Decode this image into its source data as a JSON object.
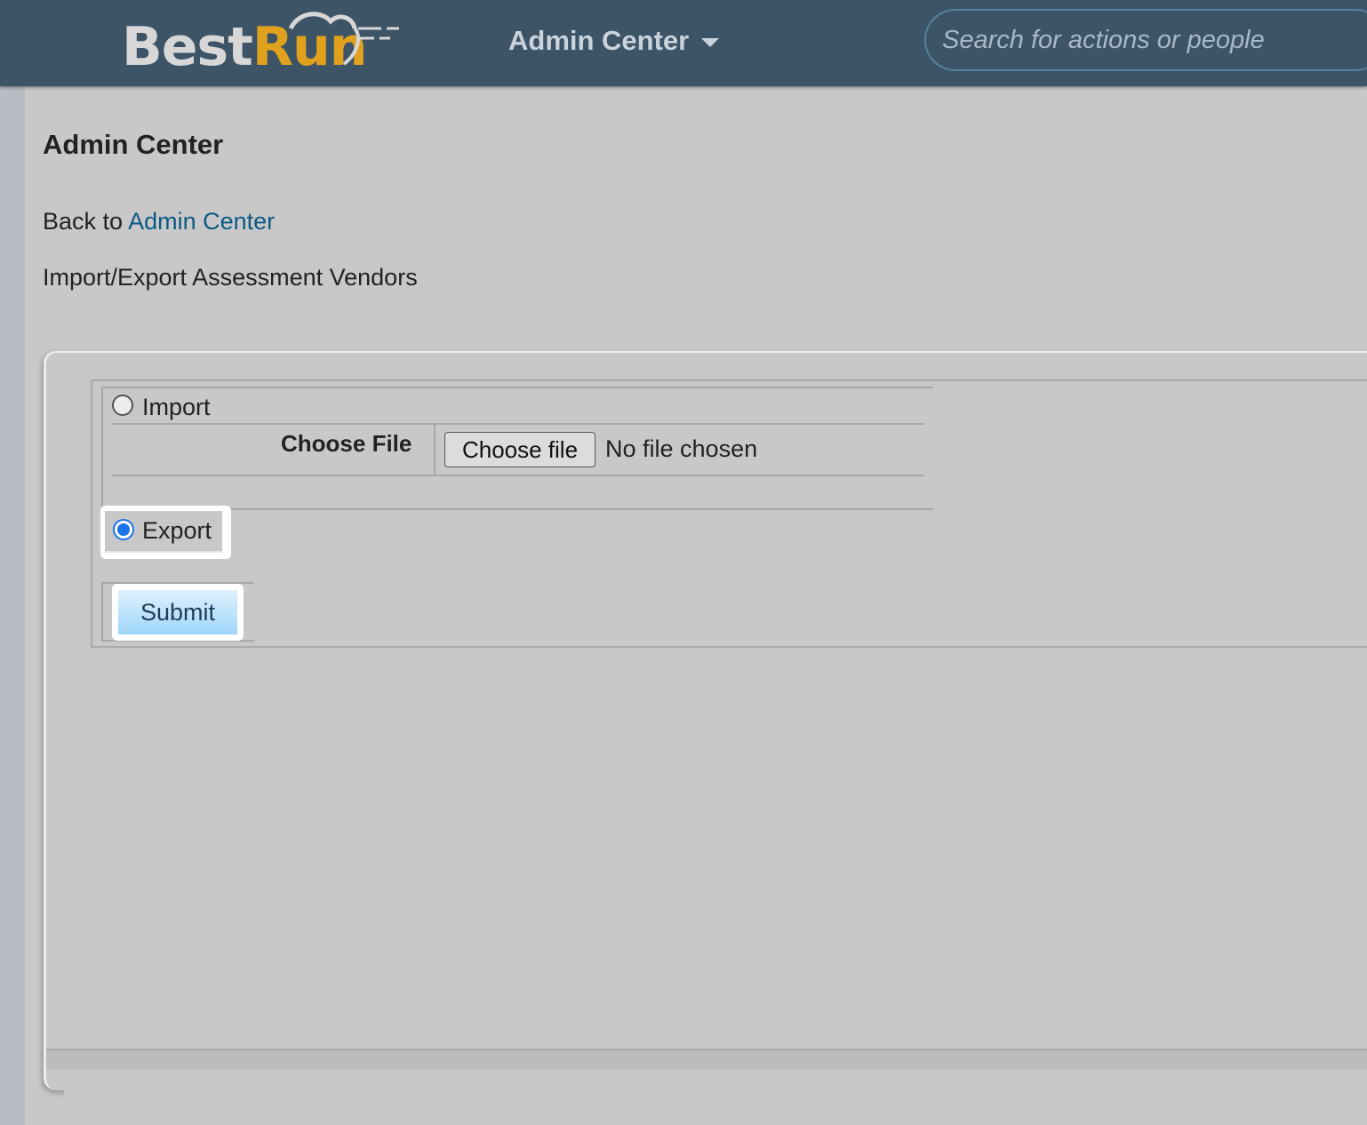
{
  "header": {
    "logo": {
      "best": "Best",
      "run": "Run"
    },
    "nav_title": "Admin Center",
    "search_placeholder": "Search for actions or people"
  },
  "page": {
    "title": "Admin Center",
    "back_prefix": "Back to",
    "back_link": "Admin Center",
    "subtitle": "Import/Export Assessment Vendors"
  },
  "form": {
    "import_label": "Import",
    "choose_file_label": "Choose File",
    "choose_file_button": "Choose file",
    "no_file_text": "No file chosen",
    "export_label": "Export",
    "selected_option": "Export",
    "submit_label": "Submit"
  },
  "colors": {
    "topbar": "#3d5467",
    "accent_gold": "#e0a21d",
    "link": "#0b5a84",
    "radio_selected": "#1a73e8"
  }
}
